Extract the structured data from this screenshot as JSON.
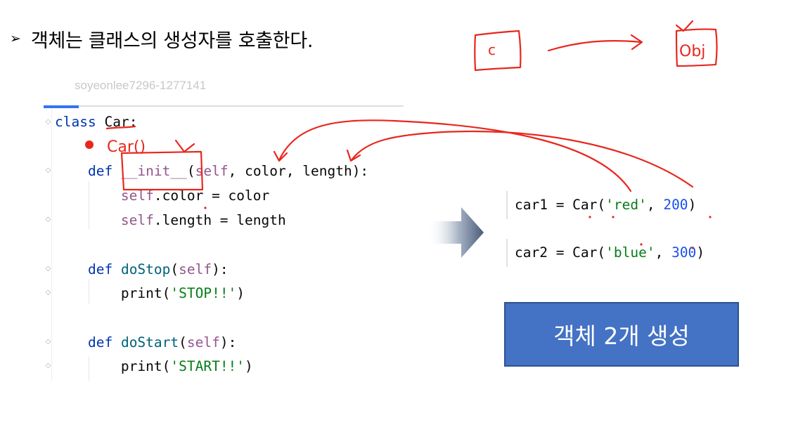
{
  "heading": {
    "bullet": "➢",
    "text": "객체는 클래스의 생성자를 호출한다."
  },
  "watermark": "soyeonlee7296-1277141",
  "code": {
    "line1": {
      "kw": "class",
      "name": "Car",
      "colon": ":"
    },
    "line2": {
      "kw": "def",
      "name": "__init__",
      "paren_open": "(",
      "self": "self",
      "rest": ", color, length):"
    },
    "line3": {
      "self": "self",
      "rest": ".color = color"
    },
    "line4": {
      "self": "self",
      "rest": ".length = length"
    },
    "line5": {
      "kw": "def",
      "name": "doStop",
      "paren_open": "(",
      "self": "self",
      "rest": "):"
    },
    "line6": {
      "fn": "print",
      "open": "(",
      "str": "'STOP!!'",
      "close": ")"
    },
    "line7": {
      "kw": "def",
      "name": "doStart",
      "paren_open": "(",
      "self": "self",
      "rest": "):"
    },
    "line8": {
      "fn": "print",
      "open": "(",
      "str": "'START!!'",
      "close": ")"
    }
  },
  "snippets": [
    {
      "var": "car1 = Car(",
      "str": "'red'",
      "sep": ", ",
      "num": "200",
      "close": ")"
    },
    {
      "var": "car2 = Car(",
      "str": "'blue'",
      "sep": ", ",
      "num": "300",
      "close": ")"
    }
  ],
  "result_button": "객체 2개 생성",
  "handwriting": {
    "class_box": "c",
    "object_box": "Obj",
    "car_call": "Car()"
  },
  "colors": {
    "annotation_red": "#e8271e",
    "button_blue": "#4472c4",
    "keyword": "#0033b3",
    "self": "#94558d",
    "string": "#067d17",
    "number": "#1750eb"
  }
}
